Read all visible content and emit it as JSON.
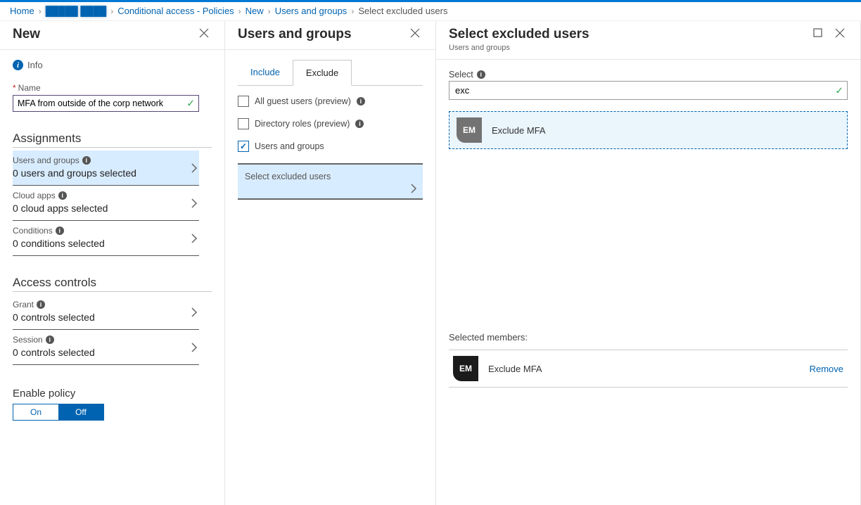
{
  "breadcrumb": {
    "items": [
      "Home",
      "█████ ████",
      "Conditional access - Policies",
      "New",
      "Users and groups"
    ],
    "last": "Select excluded users"
  },
  "blade1": {
    "title": "New",
    "info": "Info",
    "name_label": "Name",
    "name_value": "MFA from outside of the corp network",
    "assignments_h": "Assignments",
    "items": [
      {
        "label": "Users and groups",
        "value": "0 users and groups selected",
        "selected": true
      },
      {
        "label": "Cloud apps",
        "value": "0 cloud apps selected",
        "selected": false
      },
      {
        "label": "Conditions",
        "value": "0 conditions selected",
        "selected": false
      }
    ],
    "access_h": "Access controls",
    "access_items": [
      {
        "label": "Grant",
        "value": "0 controls selected"
      },
      {
        "label": "Session",
        "value": "0 controls selected"
      }
    ],
    "enable_h": "Enable policy",
    "toggle_on": "On",
    "toggle_off": "Off"
  },
  "blade2": {
    "title": "Users and groups",
    "tabs": {
      "include": "Include",
      "exclude": "Exclude"
    },
    "checks": {
      "guest": "All guest users (preview)",
      "roles": "Directory roles (preview)",
      "users": "Users and groups"
    },
    "select_action": "Select excluded users"
  },
  "blade3": {
    "title": "Select excluded users",
    "subtitle": "Users and groups",
    "select_label": "Select",
    "search_value": "exc",
    "result": {
      "initials": "EM",
      "name": "Exclude MFA"
    },
    "selected_h": "Selected members:",
    "selected": {
      "initials": "EM",
      "name": "Exclude MFA"
    },
    "remove": "Remove"
  }
}
